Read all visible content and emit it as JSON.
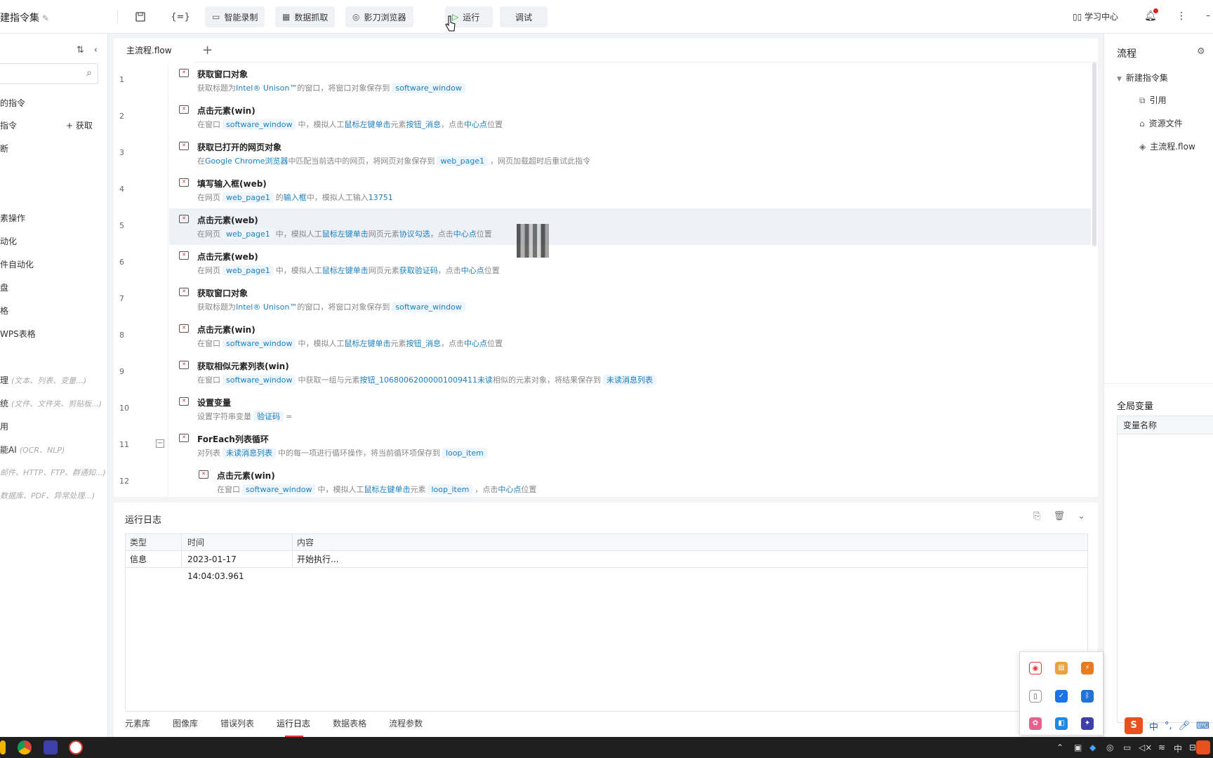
{
  "topbar": {
    "title": "建指令集",
    "smart_record": "智能录制",
    "data_capture": "数据抓取",
    "browser": "影刀浏览器",
    "run": "运行",
    "debug": "调试",
    "learning": "学习中心"
  },
  "left": {
    "items": [
      {
        "label": "的指令",
        "hint": ""
      },
      {
        "label": "指令",
        "hint": ""
      },
      {
        "label": "断",
        "hint": ""
      },
      {
        "label": "素操作",
        "hint": ""
      },
      {
        "label": "动化",
        "hint": ""
      },
      {
        "label": "件自动化",
        "hint": ""
      },
      {
        "label": "盘",
        "hint": ""
      },
      {
        "label": "格",
        "hint": ""
      },
      {
        "label": " WPS表格",
        "hint": ""
      },
      {
        "label": "理",
        "hint": "(文本、列表、变量...)"
      },
      {
        "label": "统",
        "hint": "(文件、文件夹、剪贴板...)"
      },
      {
        "label": "用",
        "hint": ""
      },
      {
        "label": "能AI",
        "hint": "(OCR、NLP)"
      },
      {
        "label": "",
        "hint": "邮件、HTTP、FTP、群通知...)"
      },
      {
        "label": "",
        "hint": "数据库、PDF、异常处理...)"
      }
    ],
    "get_label": "+ 获取"
  },
  "editor": {
    "tab": "主流程.flow",
    "line_numbers": [
      "1",
      "2",
      "3",
      "4",
      "5",
      "6",
      "7",
      "8",
      "9",
      "10",
      "11",
      "12"
    ],
    "rows": [
      {
        "title": "获取窗口对象",
        "d1": "获取标题为",
        "b1": "Intel® Unison™",
        "d2": "的窗口，将窗口对象保存到",
        "v1": "software_window",
        "d3": "",
        "b2": "",
        "d4": "",
        "v2": "",
        "d5": ""
      },
      {
        "title": "点击元素(win)",
        "d1": "在窗口",
        "v1": "software_window",
        "d2": "中，模拟人工",
        "b1": "鼠标左键单击",
        "d3": "元素",
        "b2": "按钮_消息",
        "d4": "，点击",
        "v2": "",
        "b3": "中心点",
        "d5": "位置"
      },
      {
        "title": "获取已打开的网页对象",
        "d1": "在",
        "b1": "Google Chrome浏览器",
        "d2": "中匹配当前选中的网页，将网页对象保存到",
        "v1": "web_page1",
        "d3": "，网页加载超时后重试此指令",
        "b2": "",
        "d4": "",
        "v2": "",
        "d5": ""
      },
      {
        "title": "填写输入框(web)",
        "d1": "在网页",
        "v1": "web_page1",
        "d2": "的",
        "b1": "输入框",
        "d3": "中，模拟人工输入",
        "b2": "13751",
        "d4": "",
        "v2": "",
        "d5": ""
      },
      {
        "title": "点击元素(web)",
        "d1": "在网页",
        "v1": "web_page1",
        "d2": "中，模拟人工",
        "b1": "鼠标左键单击",
        "d3": "网页元素",
        "b2": "协议勾选",
        "d4": "，点击",
        "b3": "中心点",
        "d5": "位置"
      },
      {
        "title": "点击元素(web)",
        "d1": "在网页",
        "v1": "web_page1",
        "d2": "中，模拟人工",
        "b1": "鼠标左键单击",
        "d3": "网页元素",
        "b2": "获取验证码",
        "d4": "，点击",
        "b3": "中心点",
        "d5": "位置"
      },
      {
        "title": "获取窗口对象",
        "d1": "获取标题为",
        "b1": "Intel® Unison™",
        "d2": "的窗口，将窗口对象保存到",
        "v1": "software_window",
        "d3": "",
        "b2": "",
        "d4": "",
        "v2": "",
        "d5": ""
      },
      {
        "title": "点击元素(win)",
        "d1": "在窗口",
        "v1": "software_window",
        "d2": "中，模拟人工",
        "b1": "鼠标左键单击",
        "d3": "元素",
        "b2": "按钮_消息",
        "d4": "，点击",
        "b3": "中心点",
        "d5": "位置"
      },
      {
        "title": "获取相似元素列表(win)",
        "d1": "在窗口",
        "v1": "software_window",
        "d2": "中获取一组与元素",
        "b1": "按钮_1068006200000100941​1未读",
        "d3": "相似的元素对象，将结果保存到",
        "v2": "未读消息列表",
        "b2": "",
        "d4": "",
        "d5": ""
      },
      {
        "title": "设置变量",
        "d1": "设置字符串变量",
        "v1": "验证码",
        "d2": "=",
        "b1": "",
        "d3": "",
        "b2": "",
        "d4": "",
        "v2": "",
        "d5": ""
      },
      {
        "title": "ForEach列表循环",
        "d1": "对列表",
        "v1": "未读消息列表",
        "d2": "中的每一项进行循环操作，将当前循环项保存到",
        "v2": "loop_item",
        "b1": "",
        "d3": "",
        "b2": "",
        "d4": "",
        "d5": ""
      },
      {
        "title": "点击元素(win)",
        "d1": "在窗口",
        "v1": "software_window",
        "d2": "中，模拟人工",
        "b1": "鼠标左键单击",
        "d3": "元素",
        "v2": "loop_item",
        "d4": "，点击",
        "b3": "中心点",
        "d5": "位置"
      }
    ]
  },
  "right": {
    "flow_title": "流程",
    "tree_root": "新建指令集",
    "tree_items": [
      "引用",
      "资源文件",
      "主流程.flow"
    ],
    "globals_title": "全局变量",
    "var_header": "变量名称"
  },
  "log": {
    "title": "运行日志",
    "headers": {
      "type": "类型",
      "time": "时间",
      "content": "内容"
    },
    "rows": [
      {
        "type": "信息",
        "time": "2023-01-17 14:04:03.961",
        "content": "开始执行..."
      }
    ],
    "tabs": [
      "元素库",
      "图像库",
      "错误列表",
      "运行日志",
      "数据表格",
      "流程参数"
    ]
  },
  "taskbar": {
    "ime_lang": "中"
  },
  "colors": {
    "accent": "#1a7fc0",
    "run_green": "#1aad19",
    "alert_red": "#e02020"
  }
}
